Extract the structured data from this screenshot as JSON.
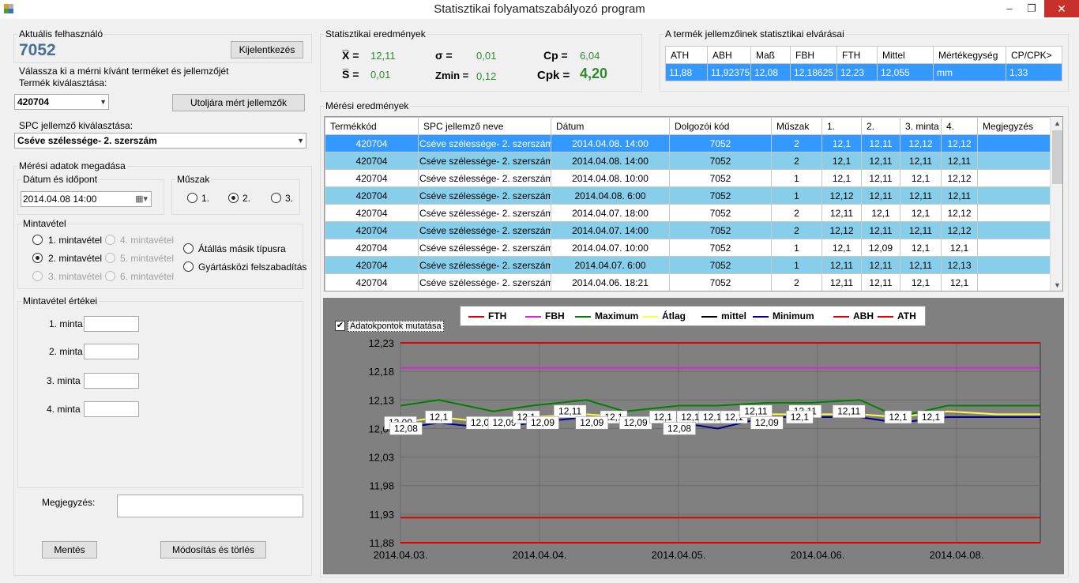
{
  "window": {
    "title": "Statisztikai folyamatszabályozó program",
    "minimize": "–",
    "maximize": "❐",
    "close": "✕"
  },
  "user": {
    "group_label": "Aktuális felhasználó",
    "id": "7052",
    "logout_label": "Kijelentkezés"
  },
  "selection": {
    "instruction": "Válassza ki a mérni kívánt terméket és jellemzőjét",
    "product_label": "Termék kiválasztása:",
    "product_value": "420704",
    "last_measured_label": "Utoljára mért jellemzők",
    "spc_label": "SPC jellemző kiválasztása:",
    "spc_value": "Cséve szélessége- 2. szerszám"
  },
  "measurement_input": {
    "group_label": "Mérési adatok megadása",
    "datetime_label": "Dátum és időpont",
    "datetime_value": "2014.04.08 14:00",
    "shift_label": "Műszak",
    "shifts": [
      "1.",
      "2.",
      "3."
    ],
    "shift_selected": 1,
    "sampling_label": "Mintavétel",
    "sampling_options": [
      "1. mintavétel",
      "2. mintavétel",
      "3. mintavétel",
      "4. mintavétel",
      "5. mintavétel",
      "6. mintavétel"
    ],
    "sampling_selected": 1,
    "switch_type_label": "Átállás másik típusra",
    "release_label": "Gyártásközi felszabadítás",
    "sample_values_label": "Mintavétel értékei",
    "samples": [
      "1. minta",
      "2. minta",
      "3. minta",
      "4. minta"
    ],
    "note_label": "Megjegyzés:",
    "save_label": "Mentés",
    "modify_label": "Módosítás és törlés"
  },
  "stats": {
    "group_label": "Statisztikai eredmények",
    "xbar_sym": "X̅ =",
    "xbar": "12,11",
    "sbar_sym": "S̅ =",
    "sbar": "0,01",
    "sigma_sym": "σ =",
    "sigma": "0,01",
    "zmin_sym": "Zmin =",
    "zmin": "0,12",
    "cp_sym": "Cp =",
    "cp": "6,04",
    "cpk_sym": "Cpk =",
    "cpk": "4,20"
  },
  "expectations": {
    "group_label": "A termék jellemzőinek statisztikai elvárásai",
    "headers": [
      "ATH",
      "ABH",
      "Maß",
      "FBH",
      "FTH",
      "Mittel",
      "Mértékegység",
      "CP/CPK>"
    ],
    "row": [
      "11,88",
      "11,92375",
      "12,08",
      "12,18625",
      "12,23",
      "12,055",
      "mm",
      "1,33"
    ]
  },
  "results": {
    "group_label": "Mérési eredmények",
    "headers": [
      "Termékkód",
      "SPC jellemző neve",
      "Dátum",
      "Dolgozói kód",
      "Műszak",
      "1.",
      "2.",
      "3. minta",
      "4.",
      "Megjegyzés"
    ],
    "rows": [
      [
        "420704",
        "Cséve szélessége- 2. szerszám",
        "2014.04.08. 14:00",
        "7052",
        "2",
        "12,1",
        "12,11",
        "12,12",
        "12,12",
        ""
      ],
      [
        "420704",
        "Cséve szélessége- 2. szerszám",
        "2014.04.08. 14:00",
        "7052",
        "2",
        "12,1",
        "12,11",
        "12,11",
        "12,11",
        ""
      ],
      [
        "420704",
        "Cséve szélessége- 2. szerszám",
        "2014.04.08. 10:00",
        "7052",
        "1",
        "12,1",
        "12,11",
        "12,1",
        "12,12",
        ""
      ],
      [
        "420704",
        "Cséve szélessége- 2. szerszám",
        "2014.04.08. 6:00",
        "7052",
        "1",
        "12,12",
        "12,11",
        "12,11",
        "12,11",
        ""
      ],
      [
        "420704",
        "Cséve szélessége- 2. szerszám",
        "2014.04.07. 18:00",
        "7052",
        "2",
        "12,11",
        "12,1",
        "12,1",
        "12,12",
        ""
      ],
      [
        "420704",
        "Cséve szélessége- 2. szerszám",
        "2014.04.07. 14:00",
        "7052",
        "2",
        "12,12",
        "12,11",
        "12,11",
        "12,12",
        ""
      ],
      [
        "420704",
        "Cséve szélessége- 2. szerszám",
        "2014.04.07. 10:00",
        "7052",
        "1",
        "12,1",
        "12,09",
        "12,1",
        "12,1",
        ""
      ],
      [
        "420704",
        "Cséve szélessége- 2. szerszám",
        "2014.04.07. 6:00",
        "7052",
        "1",
        "12,11",
        "12,11",
        "12,11",
        "12,13",
        ""
      ],
      [
        "420704",
        "Cséve szélessége- 2. szerszám",
        "2014.04.06. 18:21",
        "7052",
        "2",
        "12,11",
        "12,11",
        "12,1",
        "12,1",
        ""
      ]
    ]
  },
  "chart_controls": {
    "show_points_label": "Adatokpontok mutatása",
    "show_points": true
  },
  "colors": {
    "selected_row": "#3399ff",
    "alt_row": "#87ceeb",
    "chart_bg": "#808080",
    "stat_value": "#2f8a2f"
  },
  "chart_data": {
    "type": "line",
    "ylim": [
      11.88,
      12.23
    ],
    "yticks": [
      "12,23",
      "12,18",
      "12,13",
      "12,08",
      "12,03",
      "11,98",
      "11,93",
      "11,88"
    ],
    "xticks": [
      "2014.04.03.",
      "2014.04.04.",
      "2014.04.05.",
      "2014.04.06.",
      "2014.04.08."
    ],
    "legend": [
      "FTH",
      "FBH",
      "Maximum",
      "Átlag",
      "mittel",
      "Minimum",
      "ABH",
      "ATH"
    ],
    "legend_colors": [
      "#e00000",
      "#e020e0",
      "#008000",
      "#ffff40",
      "#000000",
      "#000090",
      "#e00000",
      "#e00000"
    ],
    "x": [
      0,
      0.35,
      0.85,
      1.2,
      1.7,
      2.05,
      2.55,
      2.9,
      3.35,
      3.75,
      4.2,
      4.55,
      5.0,
      5.45,
      5.85
    ],
    "series": [
      {
        "name": "FTH",
        "values": [
          12.23,
          12.23,
          12.23,
          12.23,
          12.23,
          12.23,
          12.23,
          12.23,
          12.23,
          12.23,
          12.23,
          12.23,
          12.23,
          12.23,
          12.23
        ]
      },
      {
        "name": "FBH",
        "values": [
          12.186,
          12.186,
          12.186,
          12.186,
          12.186,
          12.186,
          12.186,
          12.186,
          12.186,
          12.186,
          12.186,
          12.186,
          12.186,
          12.186,
          12.186
        ]
      },
      {
        "name": "Maximum",
        "values": [
          12.12,
          12.13,
          12.11,
          12.12,
          12.13,
          12.11,
          12.12,
          12.12,
          12.125,
          12.125,
          12.13,
          12.1,
          12.12,
          12.12,
          12.12
        ]
      },
      {
        "name": "Átlag",
        "values": [
          12.09,
          12.1,
          12.09,
          12.1,
          12.105,
          12.1,
          12.095,
          12.1,
          12.105,
          12.105,
          12.105,
          12.1,
          12.11,
          12.105,
          12.105
        ]
      },
      {
        "name": "Minimum",
        "values": [
          12.08,
          12.09,
          12.08,
          12.09,
          12.1,
          12.09,
          12.09,
          12.08,
          12.1,
          12.1,
          12.1,
          12.09,
          12.1,
          12.1,
          12.1
        ]
      },
      {
        "name": "ABH",
        "values": [
          11.924,
          11.924,
          11.924,
          11.924,
          11.924,
          11.924,
          11.924,
          11.924,
          11.924,
          11.924,
          11.924,
          11.924,
          11.924,
          11.924,
          11.924
        ]
      },
      {
        "name": "ATH",
        "values": [
          11.88,
          11.88,
          11.88,
          11.88,
          11.88,
          11.88,
          11.88,
          11.88,
          11.88,
          11.88,
          11.88,
          11.88,
          11.88,
          11.88,
          11.88
        ]
      }
    ],
    "point_labels": [
      {
        "x": 0,
        "y": 12.09,
        "text": "12,09"
      },
      {
        "x": 0.35,
        "y": 12.1,
        "text": "12,1"
      },
      {
        "x": 0.75,
        "y": 12.09,
        "text": "12,09"
      },
      {
        "x": 0.95,
        "y": 12.09,
        "text": "12,09"
      },
      {
        "x": 1.15,
        "y": 12.1,
        "text": "12,1"
      },
      {
        "x": 1.55,
        "y": 12.11,
        "text": "12,11"
      },
      {
        "x": 1.95,
        "y": 12.1,
        "text": "12,1"
      },
      {
        "x": 2.15,
        "y": 12.09,
        "text": "12,09"
      },
      {
        "x": 2.4,
        "y": 12.1,
        "text": "12,1"
      },
      {
        "x": 2.65,
        "y": 12.1,
        "text": "12,1"
      },
      {
        "x": 2.85,
        "y": 12.1,
        "text": "12,1"
      },
      {
        "x": 3.05,
        "y": 12.1,
        "text": "12,1"
      },
      {
        "x": 3.25,
        "y": 12.11,
        "text": "12,11"
      },
      {
        "x": 3.7,
        "y": 12.11,
        "text": "12,11"
      },
      {
        "x": 4.1,
        "y": 12.11,
        "text": "12,11"
      },
      {
        "x": 4.55,
        "y": 12.1,
        "text": "12,1"
      },
      {
        "x": 4.85,
        "y": 12.1,
        "text": "12,1"
      },
      {
        "x": 0.05,
        "y": 12.08,
        "text": "12,08"
      },
      {
        "x": 1.3,
        "y": 12.09,
        "text": "12,09"
      },
      {
        "x": 1.75,
        "y": 12.09,
        "text": "12,09"
      },
      {
        "x": 2.55,
        "y": 12.08,
        "text": "12,08"
      },
      {
        "x": 3.35,
        "y": 12.09,
        "text": "12,09"
      },
      {
        "x": 3.65,
        "y": 12.1,
        "text": "12,1"
      }
    ]
  }
}
